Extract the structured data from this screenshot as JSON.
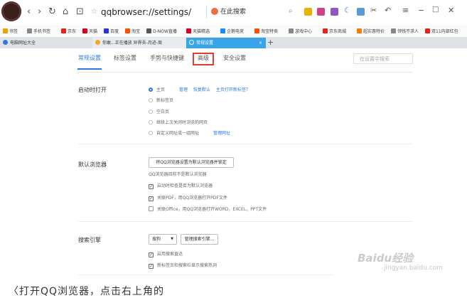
{
  "toolbar": {
    "nav_back": "‹",
    "nav_forward": "›",
    "nav_reload": "↻",
    "nav_home": "⌂",
    "nav_reader": "⊡",
    "url": "qqbrowser://settings/",
    "search_placeholder": "在此搜索"
  },
  "bookmarks": [
    {
      "label": "书签",
      "color": "#f0a000"
    },
    {
      "label": "手机书签",
      "color": "#888888"
    },
    {
      "label": "京东",
      "color": "#e1251b"
    },
    {
      "label": "天猫",
      "color": "#d9001b"
    },
    {
      "label": "百度",
      "color": "#2932e1"
    },
    {
      "label": "淘宝",
      "color": "#ff5000"
    },
    {
      "label": "D-NOW直播",
      "color": "#555555"
    },
    {
      "label": "天猫精选",
      "color": "#d9001b"
    },
    {
      "label": "企鹅电竞",
      "color": "#1a8cff"
    },
    {
      "label": "淘宝特卖",
      "color": "#ff5000"
    },
    {
      "label": "游戏中心",
      "color": "#888888"
    },
    {
      "label": "京东商城",
      "color": "#e1251b"
    },
    {
      "label": "超实惠特价",
      "color": "#f08000"
    },
    {
      "label": "领钱不求人",
      "color": "#888888"
    },
    {
      "label": "双11内部红包",
      "color": "#e1251b"
    }
  ],
  "tabs": [
    {
      "label": "电脑网址大全"
    },
    {
      "label": "你敢...正在播放 异界吾-月迹-周"
    },
    {
      "label": "常规设置"
    }
  ],
  "new_tab": "+",
  "settings": {
    "nav": [
      "常规设置",
      "标签设置",
      "手势与快捷键",
      "高级",
      "安全设置"
    ],
    "search_placeholder": "在设置中搜索",
    "startup": {
      "title": "启动时打开",
      "options": [
        "主页",
        "新标签页",
        "空白页",
        "继续上次关闭时浏览的网页",
        "自定义网址或一组网址"
      ],
      "homepage_link1": "管理",
      "homepage_link2": "恢复默认",
      "homepage_link3": "主页打开新标签？",
      "custom_link": "管理网址"
    },
    "default_browser": {
      "title": "默认浏览器",
      "button": "将QQ浏览器设置为默认浏览器并锁定",
      "note": "QQ浏览器目前不是默认浏览器",
      "options": [
        {
          "label": "启动时检查是否为默认浏览器",
          "checked": true
        },
        {
          "label": "关联PDF，用QQ浏览器打开PDF文件",
          "checked": true
        },
        {
          "label": "关联Office，用QQ浏览器打开WORD，EXCEL，PPT文件",
          "checked": false
        }
      ]
    },
    "search_engine": {
      "title": "搜索引擎",
      "selected": "搜狗",
      "manage_button": "管理搜索引擎...",
      "options": [
        {
          "label": "启用搜索直达",
          "checked": true
        },
        {
          "label": "新标签页和搜索栏显示搜索热词",
          "checked": true
        }
      ]
    }
  },
  "watermark": "Baidu经验",
  "watermark_sub": "jingyan.baidu.com",
  "bottom_text": "〈打开QQ浏览器，点击右上角的"
}
